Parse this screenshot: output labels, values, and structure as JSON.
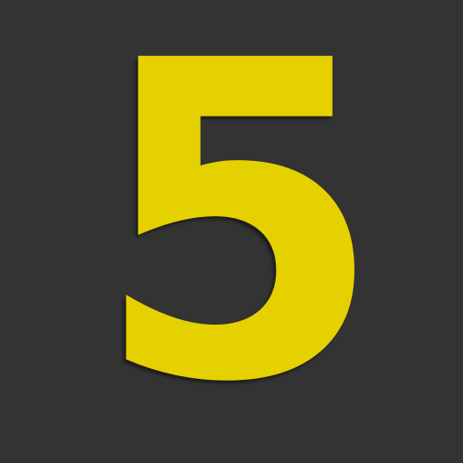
{
  "tile": {
    "digit": "5",
    "background_color": "#333333",
    "digit_color": "#e6d100"
  }
}
